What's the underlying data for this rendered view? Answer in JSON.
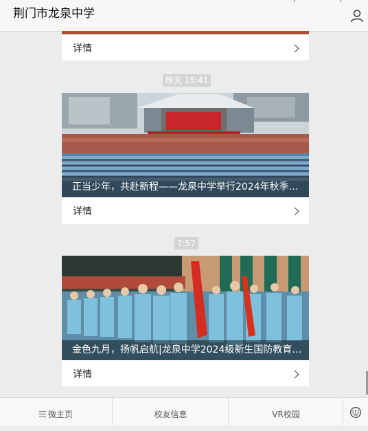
{
  "header": {
    "title": "荆门市龙泉中学"
  },
  "top_card": {
    "detail_label": "详情"
  },
  "articles": [
    {
      "time": "昨天 15:41",
      "caption": "正当少年，共赴新程——龙泉中学举行2024年秋季…",
      "detail_label": "详情"
    },
    {
      "time": "7:57",
      "caption": "金色九月，扬帆启航|龙泉中学2024级新生国防教育…",
      "detail_label": "详情"
    }
  ],
  "tabbar": {
    "items": [
      {
        "label": "微主页",
        "icon": "menu-icon"
      },
      {
        "label": "校友信息"
      },
      {
        "label": "VR校园"
      }
    ],
    "keyboard_icon": "keyboard-icon"
  },
  "colors": {
    "header_bg": "#f7f7f7",
    "page_bg": "#ececec",
    "badge_bg": "#d4d4d4"
  }
}
